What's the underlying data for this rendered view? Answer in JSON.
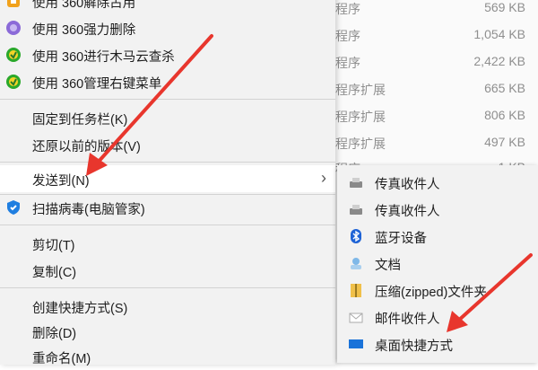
{
  "background_list": [
    {
      "type": "程序",
      "size": "569 KB"
    },
    {
      "type": "程序",
      "size": "1,054 KB"
    },
    {
      "type": "程序",
      "size": "2,422 KB"
    },
    {
      "type": "程序扩展",
      "size": "665 KB"
    },
    {
      "type": "程序扩展",
      "size": "806 KB"
    },
    {
      "type": "程序扩展",
      "size": "497 KB"
    },
    {
      "type": "程序",
      "size": "1 KB"
    }
  ],
  "context_menu": {
    "items": [
      {
        "label": "使用 360解除占用",
        "icon": "360-unlock-icon"
      },
      {
        "label": "使用 360强力删除",
        "icon": "360-delete-icon"
      },
      {
        "label": "使用 360进行木马云查杀",
        "icon": "360-trojan-scan-icon"
      },
      {
        "label": "使用 360管理右键菜单",
        "icon": "360-menu-manager-icon"
      },
      {
        "label": "固定到任务栏(K)"
      },
      {
        "label": "还原以前的版本(V)"
      },
      {
        "label": "发送到(N)"
      },
      {
        "label": "扫描病毒(电脑管家)",
        "icon": "shield-icon"
      },
      {
        "label": "剪切(T)"
      },
      {
        "label": "复制(C)"
      },
      {
        "label": "创建快捷方式(S)"
      },
      {
        "label": "删除(D)"
      },
      {
        "label": "重命名(M)"
      }
    ]
  },
  "send_to_menu": {
    "items": [
      {
        "label": "传真收件人",
        "icon": "fax-icon"
      },
      {
        "label": "传真收件人",
        "icon": "fax-icon"
      },
      {
        "label": "蓝牙设备",
        "icon": "bluetooth-icon"
      },
      {
        "label": "文档",
        "icon": "documents-icon"
      },
      {
        "label": "压缩(zipped)文件夹",
        "icon": "zip-folder-icon"
      },
      {
        "label": "邮件收件人",
        "icon": "mail-icon"
      },
      {
        "label": "桌面快捷方式",
        "icon": "desktop-icon"
      }
    ]
  },
  "colors": {
    "arrow": "#e8362d",
    "menu_bg": "#f2f2f2",
    "highlight": "#ffffff"
  }
}
